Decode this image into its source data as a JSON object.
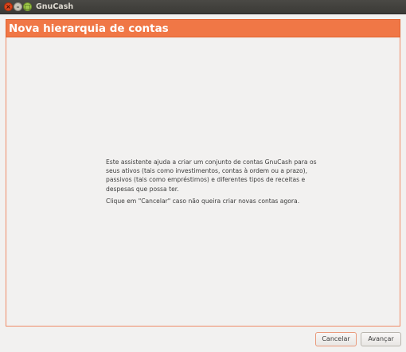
{
  "window": {
    "title": "GnuCash",
    "controls": {
      "close_glyph": "×",
      "minimize_glyph": "–",
      "maximize_glyph": "□"
    }
  },
  "assistant": {
    "page_title": "Nova hierarquia de contas",
    "intro_text": "Este assistente ajuda a criar um conjunto de contas GnuCash para os seus ativos (tais como investimentos, contas à ordem ou a prazo), passivos (tais como empréstimos) e diferentes tipos de receitas e despesas que possa ter.",
    "cancel_hint": "Clique em \"Cancelar\" caso não queira criar novas contas agora.",
    "accent_color": "#f07746"
  },
  "buttons": {
    "cancel_label": "Cancelar",
    "next_label": "Avançar"
  }
}
